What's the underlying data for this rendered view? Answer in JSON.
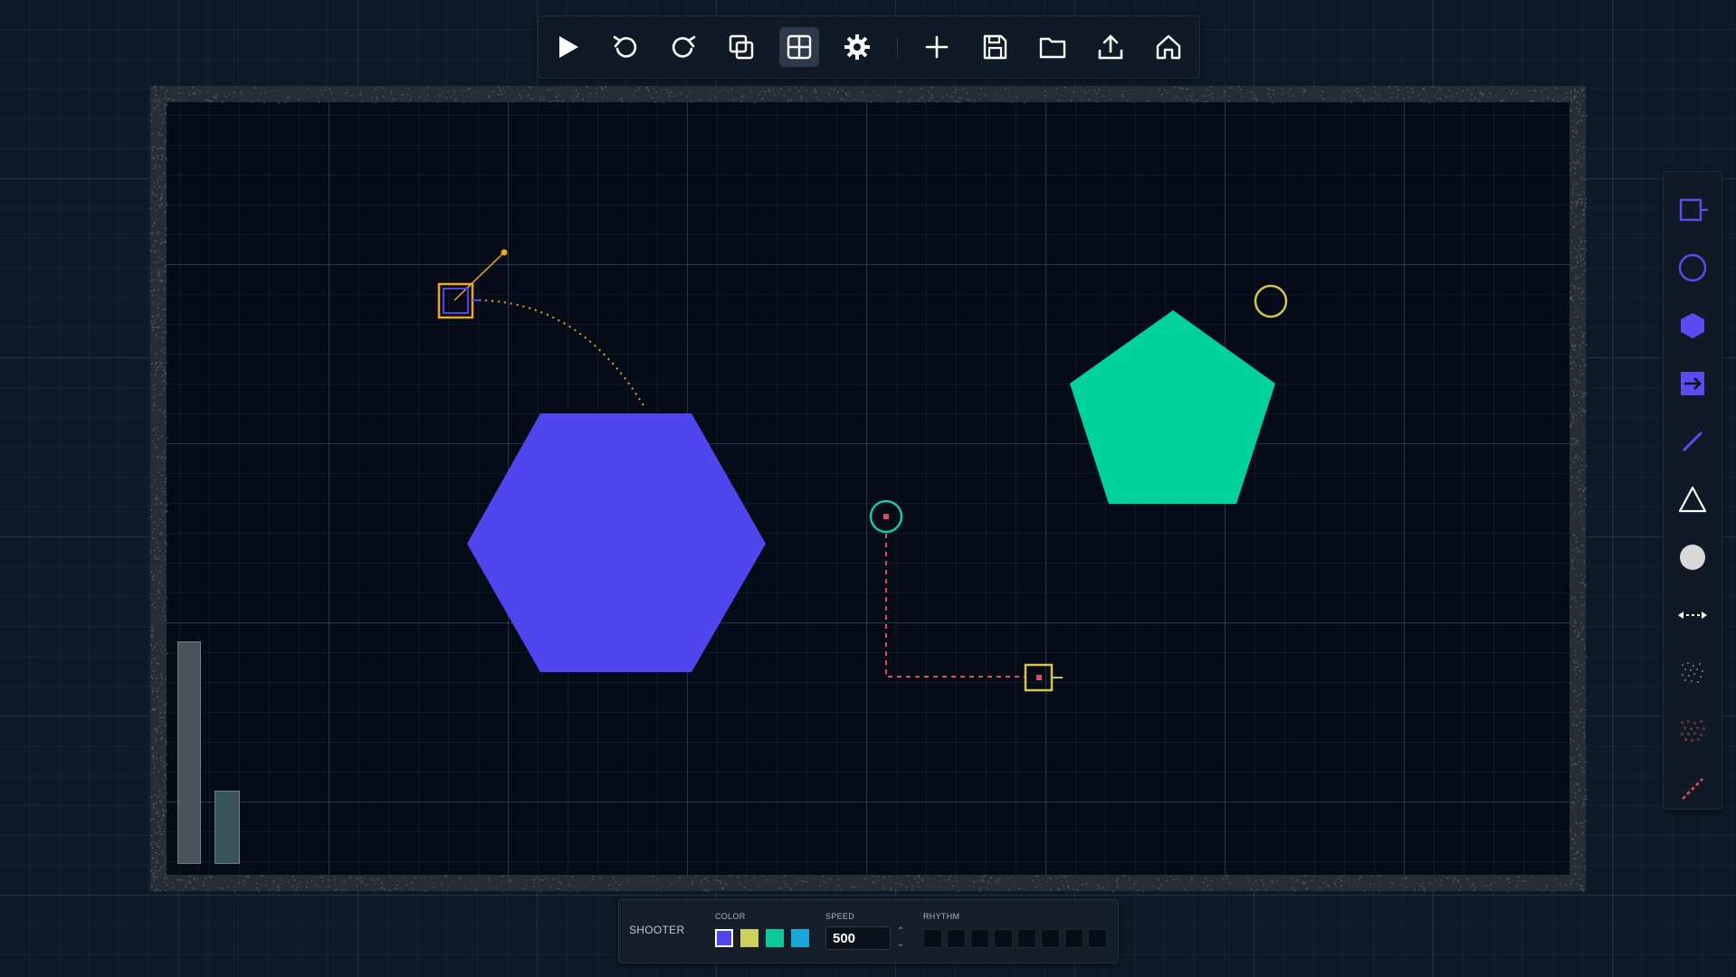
{
  "toolbar": {
    "buttons": [
      {
        "name": "play",
        "icon": "play-icon"
      },
      {
        "name": "undo",
        "icon": "undo-icon"
      },
      {
        "name": "redo",
        "icon": "redo-icon"
      },
      {
        "name": "duplicate",
        "icon": "duplicate-icon"
      },
      {
        "name": "grid",
        "icon": "grid-icon",
        "active": true
      },
      {
        "name": "settings",
        "icon": "gear-icon"
      },
      {
        "name": "add",
        "icon": "plus-icon"
      },
      {
        "name": "save",
        "icon": "save-icon"
      },
      {
        "name": "open",
        "icon": "folder-icon"
      },
      {
        "name": "export",
        "icon": "upload-icon"
      },
      {
        "name": "home",
        "icon": "home-icon"
      }
    ]
  },
  "canvas": {
    "shapes": [
      {
        "name": "hexagon",
        "color": "#5046ee"
      },
      {
        "name": "pentagon",
        "color": "#00d29b"
      }
    ],
    "objects": [
      {
        "name": "shooter",
        "color": "#f0a424"
      },
      {
        "name": "target-circle",
        "color": "#d3c64a"
      },
      {
        "name": "emitter",
        "color": "#17c99e"
      },
      {
        "name": "receiver",
        "color": "#d3c64a"
      },
      {
        "name": "laser-path",
        "color": "#e04a5a"
      }
    ]
  },
  "palette": {
    "tools": [
      {
        "name": "shooter",
        "icon": "shooter-icon",
        "color": "#5a4cf0"
      },
      {
        "name": "circle",
        "icon": "circle-icon",
        "color": "#5a4cf0"
      },
      {
        "name": "hexagon",
        "icon": "hexagon-icon",
        "color": "#5a4cf0"
      },
      {
        "name": "arrow-block",
        "icon": "arrow-block-icon",
        "color": "#5a4cf0"
      },
      {
        "name": "line",
        "icon": "line-icon",
        "color": "#5a4cf0"
      },
      {
        "name": "triangle",
        "icon": "triangle-icon",
        "color": "#ffffff"
      },
      {
        "name": "ball",
        "icon": "ball-icon",
        "color": "#d8d8d8"
      },
      {
        "name": "portal",
        "icon": "portal-icon",
        "color": "#ffffff"
      },
      {
        "name": "noise",
        "icon": "noise-icon",
        "color": "#5d6873"
      },
      {
        "name": "red-noise",
        "icon": "red-noise-icon",
        "color": "#5e3338"
      },
      {
        "name": "laser",
        "icon": "laser-icon",
        "color": "#e04a5a"
      }
    ]
  },
  "panel": {
    "title": "SHOOTER",
    "color_label": "COLOR",
    "speed_label": "SPEED",
    "rhythm_label": "RHYTHM",
    "colors": [
      "#5046ee",
      "#cfcf5e",
      "#0fc898",
      "#1aa7da"
    ],
    "selected_color": "#5046ee",
    "speed": "500",
    "rhythm": [
      false,
      false,
      false,
      false,
      false,
      false,
      false,
      false
    ]
  }
}
